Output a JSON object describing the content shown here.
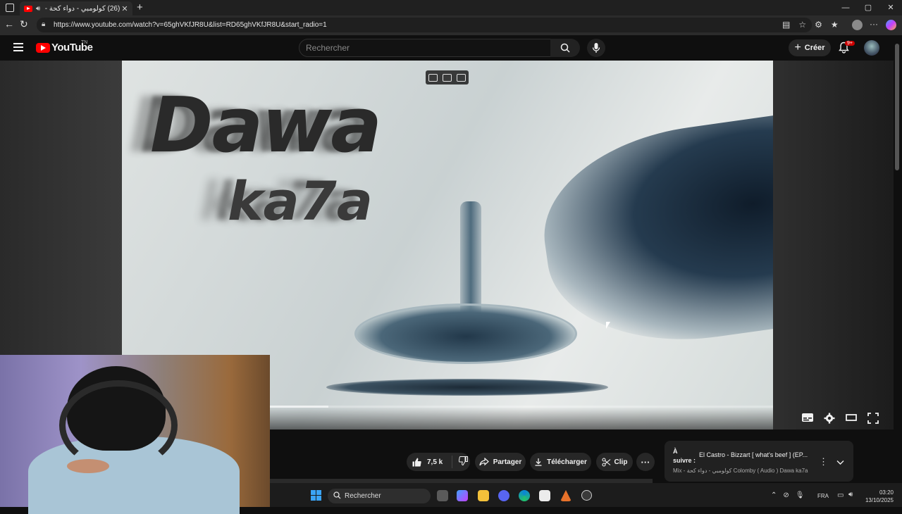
{
  "browser": {
    "tab": {
      "title": "(26) كولومبي - دواء كحة - YouTube",
      "audio_icon": "speaker-icon"
    },
    "window_controls": [
      "—",
      "▢",
      "✕"
    ],
    "url": "https://www.youtube.com/watch?v=65ghVKfJR8U&list=RD65ghVKfJR8U&start_radio=1"
  },
  "youtube": {
    "logo_text": "YouTube",
    "logo_country": "TN",
    "search_placeholder": "Rechercher",
    "create_label": "Créer",
    "notifications_badge": "9+"
  },
  "video": {
    "title_line1": "Dawa",
    "title_line2": "ka7a",
    "progress": 0.317
  },
  "actions": {
    "likes": "7,5 k",
    "share_label": "Partager",
    "download_label": "Télécharger",
    "clip_label": "Clip",
    "more_label": "···"
  },
  "up_next": {
    "label": "À suivre :",
    "title": "El Castro - Bizzart [ what's beef ] (EP...",
    "subtitle": "Mix - كولومبي - دواء كحة Colomby ( Audio ) Dawa ka7a"
  },
  "taskbar": {
    "search_label": "Rechercher",
    "language": "FRA",
    "time": "03:20",
    "date": "13/10/2025"
  },
  "colors": {
    "youtube_red": "#ff0000",
    "background": "#0f0f0f",
    "pill": "#272727",
    "windows_blue": "#3ba4f5"
  }
}
